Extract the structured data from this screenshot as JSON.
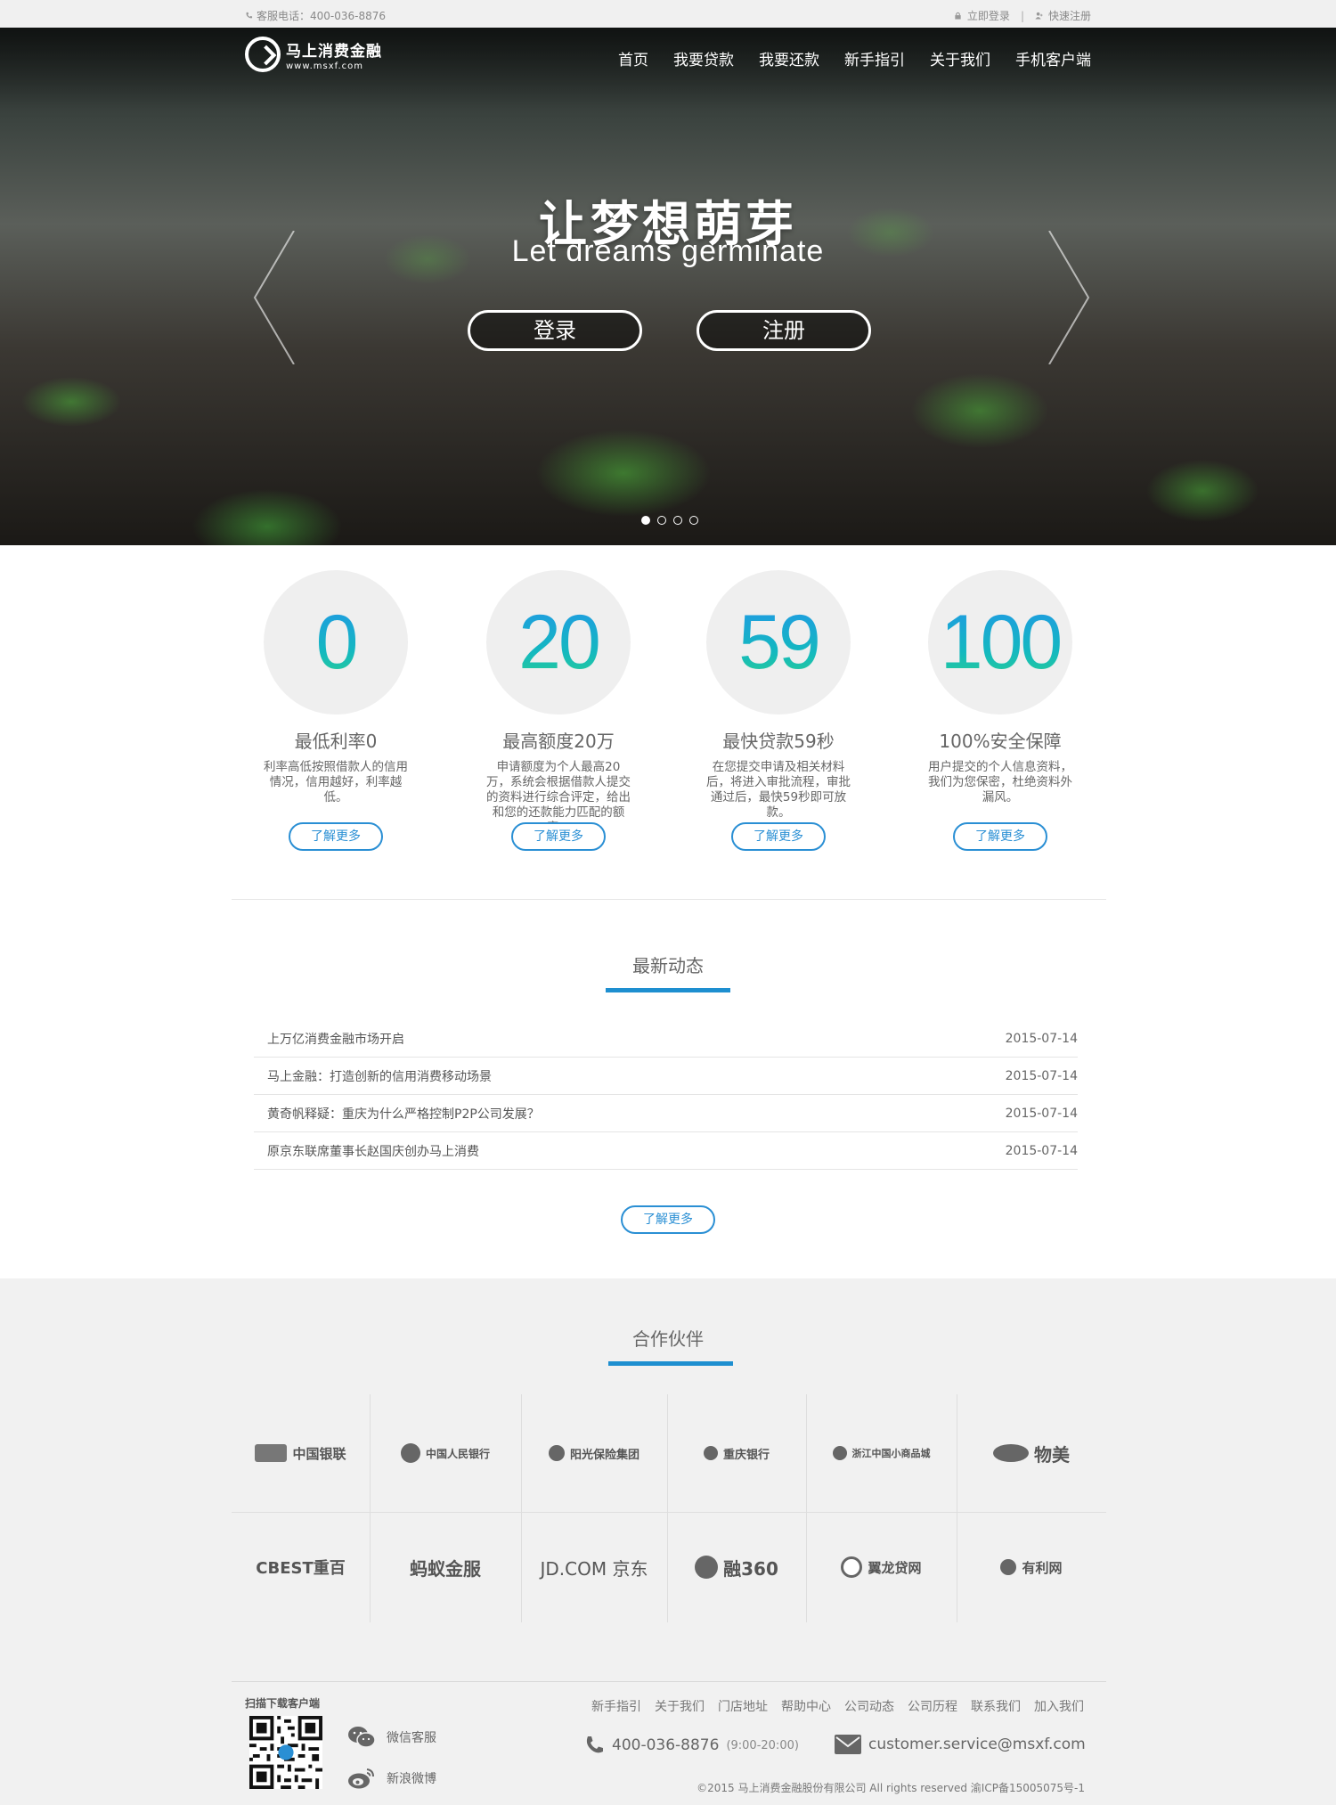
{
  "topbar": {
    "phone": "客服电话：400-036-8876",
    "login": "立即登录",
    "register": "快速注册",
    "separator": "|"
  },
  "header": {
    "logo_name": "马上消费金融",
    "logo_url": "www.msxf.com",
    "nav": [
      "首页",
      "我要贷款",
      "我要还款",
      "新手指引",
      "关于我们",
      "手机客户端"
    ]
  },
  "hero": {
    "title": "让梦想萌芽",
    "subtitle": "Let dreams germinate",
    "login_button": "登录",
    "register_button": "注册",
    "slide_count": 4,
    "active_slide": 1
  },
  "features": [
    {
      "number": "0",
      "title": "最低利率0",
      "desc": "利率高低按照借款人的信用情况，信用越好，利率越低。",
      "more": "了解更多"
    },
    {
      "number": "20",
      "title": "最高额度20万",
      "desc": "申请额度为个人最高20万，系统会根据借款人提交的资料进行综合评定，给出和您的还款能力匹配的额度。",
      "more": "了解更多"
    },
    {
      "number": "59",
      "title": "最快贷款59秒",
      "desc": "在您提交申请及相关材料后，将进入审批流程，审批通过后，最快59秒即可放款。",
      "more": "了解更多"
    },
    {
      "number": "100",
      "title": "100%安全保障",
      "desc": "用户提交的个人信息资料，我们为您保密，杜绝资料外漏风。",
      "more": "了解更多"
    }
  ],
  "news": {
    "title": "最新动态",
    "items": [
      {
        "title": "上万亿消费金融市场开启",
        "date": "2015-07-14"
      },
      {
        "title": "马上金融：打造创新的信用消费移动场景",
        "date": "2015-07-14"
      },
      {
        "title": "黄奇帆释疑：重庆为什么严格控制P2P公司发展？",
        "date": "2015-07-14"
      },
      {
        "title": "原京东联席董事长赵国庆创办马上消费",
        "date": "2015-07-14"
      }
    ],
    "more": "了解更多"
  },
  "partners": {
    "title": "合作伙伴",
    "logos": [
      "中国银联",
      "中国人民银行",
      "阳光保险集团",
      "重庆银行",
      "浙江中国小商品城",
      "物美",
      "CBEST重百",
      "蚂蚁金服",
      "JD.COM 京东",
      "融360",
      "翼龙贷网",
      "有利网"
    ]
  },
  "footer": {
    "qr_label": "扫描下载客户端",
    "wechat": "微信客服",
    "weibo": "新浪微博",
    "nav": [
      "新手指引",
      "关于我们",
      "门店地址",
      "帮助中心",
      "公司动态",
      "公司历程",
      "联系我们",
      "加入我们"
    ],
    "phone": "400-036-8876",
    "hours": "(9:00-20:00)",
    "email": "customer.service@msxf.com",
    "copyright": "©2015 马上消费金融股份有限公司 All rights reserved 渝ICP备15005075号-1"
  },
  "colors": {
    "accent": "#1e8fd0",
    "gray_bg": "#f1f1f1"
  }
}
